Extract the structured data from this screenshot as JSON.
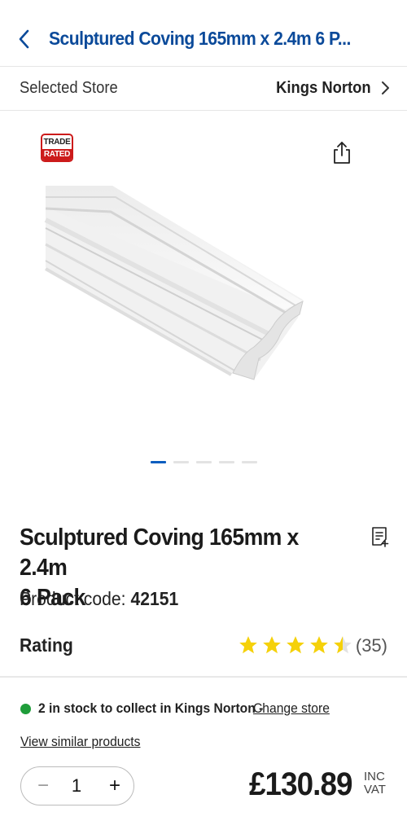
{
  "header": {
    "title": "Sculptured Coving 165mm x 2.4m 6 P..."
  },
  "store": {
    "label": "Selected Store",
    "name": "Kings Norton"
  },
  "badge": {
    "line1": "TRADE",
    "line2": "RATED"
  },
  "gallery": {
    "dot_count": 5,
    "active_index": 0
  },
  "product": {
    "title": "Sculptured Coving 165mm x 2.4m\n6 Pack",
    "code_label": "Product code: ",
    "code": "42151"
  },
  "rating": {
    "label": "Rating",
    "stars": 4.5,
    "count": "(35)",
    "star_color": "#f5d10a"
  },
  "stock": {
    "text": "2 in stock to collect in Kings Norton - ",
    "change_link": "Change store",
    "status_color": "#1f9d3a"
  },
  "similar_link": "View similar products",
  "quantity": {
    "minus": "−",
    "value": "1",
    "plus": "+"
  },
  "price": {
    "amount": "£130.89",
    "vat_line1": "INC",
    "vat_line2": "VAT"
  },
  "colors": {
    "brand_blue": "#0b4a9a",
    "trade_red": "#cc1b1b"
  }
}
